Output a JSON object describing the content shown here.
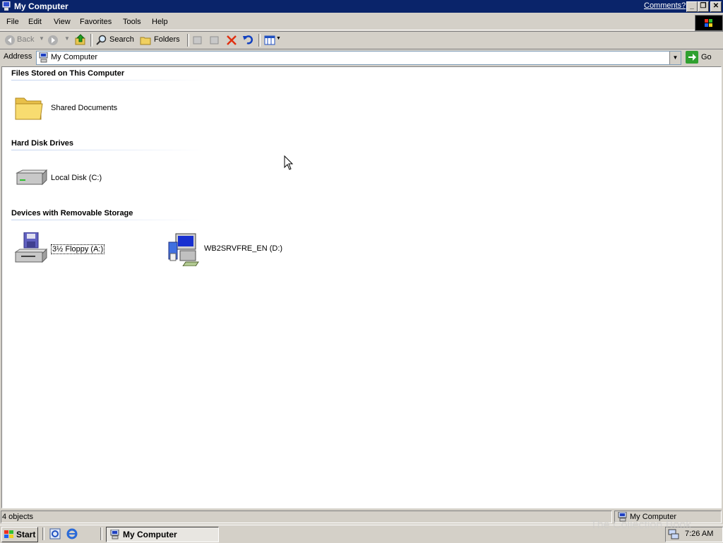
{
  "window": {
    "title": "My Computer",
    "comments_link": "Comments?",
    "caption_buttons": {
      "minimize": "_",
      "restore": "❐",
      "close": "✕"
    }
  },
  "menubar": {
    "items": [
      {
        "label": "File"
      },
      {
        "label": "Edit"
      },
      {
        "label": "View"
      },
      {
        "label": "Favorites"
      },
      {
        "label": "Tools"
      },
      {
        "label": "Help"
      }
    ]
  },
  "toolbar": {
    "back_label": "Back",
    "search_label": "Search",
    "folders_label": "Folders"
  },
  "address": {
    "label": "Address",
    "value": "My Computer",
    "go_label": "Go"
  },
  "groups": [
    {
      "title": "Files Stored on This Computer",
      "items": [
        {
          "label": "Shared Documents",
          "icon": "folder-icon"
        }
      ]
    },
    {
      "title": "Hard Disk Drives",
      "items": [
        {
          "label": "Local Disk (C:)",
          "icon": "hard-disk-icon"
        }
      ]
    },
    {
      "title": "Devices with Removable Storage",
      "items": [
        {
          "label": "3½ Floppy (A:)",
          "icon": "floppy-drive-icon"
        },
        {
          "label": "WB2SRVFRE_EN (D:)",
          "icon": "cd-drive-icon"
        }
      ]
    }
  ],
  "statusbar": {
    "objects": "4 objects",
    "location": "My Computer"
  },
  "taskbar": {
    "start_label": "Start",
    "task_label": "My Computer",
    "clock": "7:26 AM"
  },
  "watermark": "The Collection Book",
  "colors": {
    "titlebar": "#0a246a",
    "face": "#d4d0c8",
    "content_bg": "#ffffff"
  }
}
